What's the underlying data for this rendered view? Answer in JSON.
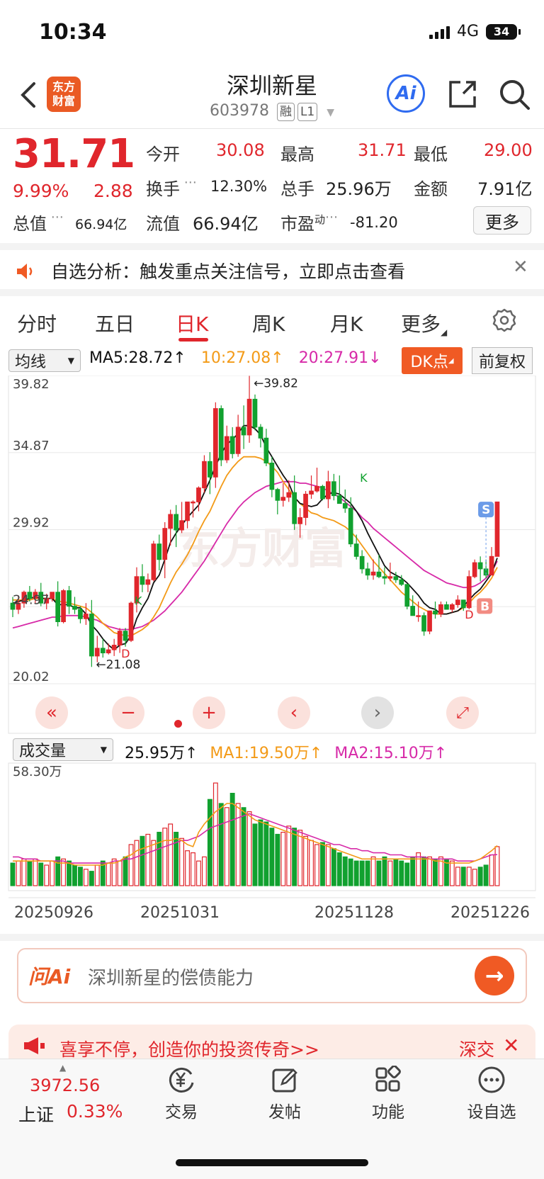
{
  "status_bar": {
    "time": "10:34",
    "network": "4G",
    "battery": "34"
  },
  "header": {
    "name": "深圳新星",
    "code": "603978",
    "tags": [
      "融",
      "L1"
    ],
    "logo_text": "东方财富",
    "ai_label": "Ai"
  },
  "quote": {
    "price": "31.71",
    "change_pct": "9.99%",
    "change_amt": "2.88",
    "fields": [
      {
        "label": "今开",
        "value": "30.08"
      },
      {
        "label": "最高",
        "value": "31.71"
      },
      {
        "label": "最低",
        "value": "29.00"
      },
      {
        "label": "换手",
        "value": "12.30%"
      },
      {
        "label": "总手",
        "value": "25.96万"
      },
      {
        "label": "金额",
        "value": "7.91亿"
      },
      {
        "label": "总值",
        "value": "66.94亿"
      },
      {
        "label": "流值",
        "value": "66.94亿"
      },
      {
        "label": "市盈",
        "value": "-81.20"
      }
    ],
    "pe_sup": "动",
    "more_label": "更多"
  },
  "news": {
    "text": "自选分析：触发重点关注信号，立即点击查看"
  },
  "tabs": [
    "分时",
    "五日",
    "日K",
    "周K",
    "月K",
    "更多"
  ],
  "indicator": {
    "selector": "均线",
    "ma5": "MA5:28.72",
    "ma10": "10:27.08",
    "ma20": "20:27.91",
    "dk_label": "DK点",
    "adjust_label": "前复权"
  },
  "chart_data": {
    "type": "candlestick",
    "y_ticks": [
      "39.82",
      "34.87",
      "29.92",
      "24.97",
      "20.02"
    ],
    "ylim": [
      20.02,
      39.82
    ],
    "high_annotation": "39.82",
    "low_annotation": "21.08",
    "markers": [
      "K",
      "K",
      "S",
      "B",
      "D",
      "D"
    ],
    "watermark": "东方财富",
    "candles": [
      [
        25.2,
        25.6,
        24.3,
        24.8
      ],
      [
        24.8,
        25.7,
        24.5,
        25.2
      ],
      [
        25.2,
        26.0,
        24.9,
        25.9
      ],
      [
        25.9,
        26.3,
        25.3,
        25.5
      ],
      [
        25.5,
        26.1,
        25.2,
        25.9
      ],
      [
        25.9,
        26.5,
        25.0,
        25.2
      ],
      [
        25.2,
        25.8,
        24.8,
        25.5
      ],
      [
        25.5,
        25.9,
        25.3,
        25.9
      ],
      [
        25.9,
        26.6,
        23.7,
        24.0
      ],
      [
        24.0,
        26.1,
        23.9,
        26.0
      ],
      [
        26.0,
        26.3,
        24.5,
        25.0
      ],
      [
        25.0,
        25.6,
        24.5,
        24.8
      ],
      [
        24.8,
        25.0,
        23.9,
        24.2
      ],
      [
        24.2,
        25.2,
        23.8,
        24.5
      ],
      [
        24.5,
        25.4,
        21.1,
        21.8
      ],
      [
        21.8,
        23.1,
        21.4,
        22.3
      ],
      [
        22.3,
        22.9,
        21.7,
        22.0
      ],
      [
        22.0,
        22.6,
        21.9,
        22.2
      ],
      [
        22.2,
        22.9,
        21.8,
        22.5
      ],
      [
        22.5,
        23.6,
        22.0,
        23.4
      ],
      [
        23.4,
        23.6,
        22.4,
        22.8
      ],
      [
        22.8,
        25.3,
        22.7,
        25.2
      ],
      [
        25.2,
        27.5,
        24.6,
        26.9
      ],
      [
        26.9,
        27.7,
        25.9,
        26.4
      ],
      [
        26.4,
        27.1,
        25.9,
        26.7
      ],
      [
        26.7,
        29.2,
        26.6,
        29.0
      ],
      [
        29.0,
        29.6,
        27.3,
        28.0
      ],
      [
        28.0,
        30.4,
        26.8,
        30.0
      ],
      [
        30.0,
        31.2,
        28.9,
        30.9
      ],
      [
        30.9,
        31.5,
        28.8,
        29.9
      ],
      [
        29.9,
        31.7,
        29.7,
        30.5
      ],
      [
        30.5,
        31.7,
        30.0,
        31.7
      ],
      [
        31.7,
        31.8,
        30.7,
        31.7
      ],
      [
        31.7,
        32.7,
        31.1,
        32.6
      ],
      [
        32.6,
        34.7,
        32.3,
        34.3
      ],
      [
        34.3,
        34.9,
        32.2,
        33.3
      ],
      [
        33.3,
        38.1,
        32.6,
        37.7
      ],
      [
        37.7,
        37.9,
        34.0,
        34.4
      ],
      [
        34.4,
        36.6,
        34.2,
        35.9
      ],
      [
        35.9,
        36.5,
        34.5,
        34.8
      ],
      [
        34.8,
        37.3,
        34.6,
        36.5
      ],
      [
        36.5,
        37.9,
        35.1,
        36.0
      ],
      [
        36.0,
        39.8,
        35.5,
        38.3
      ],
      [
        38.3,
        38.6,
        36.3,
        36.5
      ],
      [
        36.5,
        36.7,
        35.2,
        35.8
      ],
      [
        35.8,
        36.4,
        34.0,
        34.2
      ],
      [
        34.2,
        34.6,
        32.0,
        32.5
      ],
      [
        32.5,
        32.6,
        30.9,
        31.8
      ],
      [
        31.8,
        32.9,
        31.4,
        32.0
      ],
      [
        32.0,
        33.1,
        31.7,
        32.3
      ],
      [
        32.3,
        33.4,
        29.9,
        30.3
      ],
      [
        30.3,
        31.3,
        29.4,
        30.7
      ],
      [
        30.7,
        32.4,
        30.2,
        32.2
      ],
      [
        32.2,
        33.4,
        31.9,
        32.4
      ],
      [
        32.4,
        33.9,
        32.3,
        32.7
      ],
      [
        32.7,
        32.8,
        31.8,
        31.9
      ],
      [
        31.9,
        33.7,
        31.3,
        33.0
      ],
      [
        33.0,
        33.5,
        31.8,
        32.1
      ],
      [
        32.1,
        33.4,
        31.6,
        31.6
      ],
      [
        31.6,
        32.5,
        31.0,
        31.3
      ],
      [
        31.3,
        32.0,
        28.8,
        29.0
      ],
      [
        29.0,
        29.6,
        28.0,
        28.2
      ],
      [
        28.2,
        28.6,
        27.1,
        27.4
      ],
      [
        27.4,
        27.8,
        26.7,
        27.0
      ],
      [
        27.0,
        28.0,
        26.7,
        27.2
      ],
      [
        27.2,
        28.3,
        26.8,
        26.9
      ],
      [
        26.9,
        27.5,
        26.4,
        26.8
      ],
      [
        26.8,
        27.8,
        26.6,
        26.9
      ],
      [
        26.9,
        27.2,
        26.5,
        26.7
      ],
      [
        26.7,
        27.0,
        26.3,
        26.4
      ],
      [
        26.4,
        26.4,
        24.8,
        25.0
      ],
      [
        25.0,
        25.7,
        24.4,
        24.4
      ],
      [
        24.4,
        25.3,
        24.0,
        24.4
      ],
      [
        24.4,
        24.6,
        23.1,
        23.4
      ],
      [
        23.4,
        24.7,
        23.2,
        24.7
      ],
      [
        24.7,
        25.3,
        24.2,
        24.5
      ],
      [
        24.5,
        25.3,
        24.3,
        25.1
      ],
      [
        25.1,
        25.3,
        24.8,
        24.8
      ],
      [
        24.8,
        25.2,
        24.6,
        25.1
      ],
      [
        25.1,
        25.7,
        24.9,
        25.4
      ],
      [
        25.4,
        25.4,
        24.7,
        24.9
      ],
      [
        24.9,
        27.3,
        24.8,
        26.9
      ],
      [
        26.9,
        28.0,
        26.8,
        27.8
      ],
      [
        27.8,
        28.2,
        26.6,
        27.4
      ],
      [
        27.4,
        28.0,
        26.8,
        27.0
      ],
      [
        27.0,
        28.8,
        27.0,
        28.2
      ],
      [
        28.2,
        31.7,
        28.2,
        31.7
      ]
    ],
    "ma5": [
      25.2,
      25.3,
      25.4,
      25.5,
      25.6,
      25.5,
      25.5,
      25.5,
      25.1,
      25.1,
      25.1,
      24.9,
      24.9,
      24.5,
      23.8,
      23.4,
      22.9,
      22.5,
      22.2,
      22.5,
      22.6,
      23.1,
      24.2,
      24.9,
      25.5,
      26.5,
      27.0,
      28.0,
      29.1,
      29.7,
      30.2,
      30.7,
      31.1,
      31.5,
      32.3,
      33.1,
      34.0,
      34.8,
      35.4,
      35.7,
      36.1,
      36.6,
      36.6,
      36.4,
      36.0,
      35.2,
      34.6,
      34.0,
      33.4,
      32.9,
      32.0,
      31.6,
      31.5,
      31.4,
      31.5,
      31.9,
      32.2,
      32.3,
      32.2,
      31.9,
      31.6,
      31.1,
      30.5,
      29.7,
      29.0,
      28.3,
      27.6,
      27.2,
      27.0,
      26.8,
      26.5,
      26.1,
      25.7,
      25.2,
      24.9,
      24.8,
      24.5,
      24.5,
      24.6,
      24.7,
      25.0,
      25.4,
      25.8,
      26.1,
      26.6,
      27.1,
      28.1
    ],
    "ma10": [
      25.4,
      25.4,
      25.4,
      25.4,
      25.5,
      25.5,
      25.5,
      25.5,
      25.3,
      25.3,
      25.2,
      25.1,
      25.0,
      24.9,
      24.6,
      24.3,
      23.9,
      23.6,
      23.3,
      23.2,
      23.1,
      23.1,
      23.3,
      23.5,
      23.8,
      24.3,
      24.9,
      25.7,
      26.5,
      27.2,
      27.7,
      28.3,
      29.0,
      29.8,
      30.5,
      31.1,
      31.9,
      32.7,
      33.4,
      33.9,
      34.3,
      34.6,
      34.6,
      34.6,
      34.5,
      34.3,
      34.0,
      33.6,
      33.0,
      32.5,
      32.0,
      31.6,
      31.3,
      31.0,
      30.9,
      30.7,
      30.6,
      30.5,
      30.3,
      30.1,
      29.8,
      29.4,
      28.9,
      28.4,
      27.9,
      27.5,
      27.1,
      26.7,
      26.3,
      25.9,
      25.6,
      25.3,
      25.0,
      24.8,
      24.6,
      24.5,
      24.5,
      24.5,
      24.6,
      24.7,
      24.9,
      25.2,
      25.6,
      25.9,
      26.3,
      26.8,
      27.5
    ],
    "ma20": [
      23.6,
      23.7,
      23.8,
      23.9,
      24.0,
      24.1,
      24.2,
      24.3,
      24.3,
      24.4,
      24.4,
      24.4,
      24.4,
      24.3,
      24.2,
      24.1,
      23.9,
      23.7,
      23.6,
      23.5,
      23.5,
      23.5,
      23.6,
      23.7,
      23.9,
      24.1,
      24.4,
      24.7,
      25.1,
      25.5,
      25.9,
      26.4,
      26.9,
      27.4,
      27.9,
      28.5,
      29.1,
      29.7,
      30.3,
      30.8,
      31.3,
      31.7,
      32.0,
      32.3,
      32.5,
      32.7,
      32.8,
      32.9,
      33.0,
      33.0,
      33.0,
      32.9,
      32.9,
      32.8,
      32.7,
      32.6,
      32.4,
      32.2,
      32.0,
      31.7,
      31.4,
      31.1,
      30.7,
      30.4,
      30.0,
      29.7,
      29.4,
      29.1,
      28.8,
      28.5,
      28.2,
      27.9,
      27.6,
      27.3,
      27.1,
      26.9,
      26.7,
      26.5,
      26.4,
      26.3,
      26.2,
      26.2,
      26.3,
      26.5,
      26.8,
      27.2,
      27.9
    ]
  },
  "volume": {
    "selector": "成交量",
    "vol": "25.95万",
    "ma1": "MA1:19.50万",
    "ma2": "MA2:15.10万",
    "max_label": "58.30万",
    "max": 58.3,
    "bars": [
      11,
      12,
      13,
      12,
      13,
      11,
      10,
      12,
      14,
      13,
      12,
      10,
      9,
      8,
      7,
      10,
      12,
      11,
      13,
      12,
      14,
      20,
      22,
      24,
      25,
      22,
      26,
      28,
      30,
      26,
      23,
      17,
      16,
      12,
      14,
      42,
      50,
      40,
      38,
      45,
      40,
      38,
      36,
      30,
      32,
      31,
      28,
      25,
      26,
      29,
      28,
      27,
      24,
      22,
      20,
      21,
      20,
      18,
      16,
      14,
      13,
      12,
      12,
      12,
      14,
      12,
      14,
      12,
      13,
      12,
      11,
      14,
      16,
      14,
      14,
      13,
      14,
      13,
      12,
      9,
      9,
      9,
      8,
      9,
      10,
      15,
      19
    ],
    "ma1_line": [
      12,
      12,
      12,
      12,
      12,
      12,
      12,
      12,
      11,
      11,
      11,
      10,
      10,
      10,
      10,
      10,
      10,
      11,
      11,
      12,
      14,
      15,
      17,
      18,
      19,
      20,
      21,
      22,
      22,
      23,
      22,
      20,
      19,
      26,
      30,
      33,
      36,
      38,
      40,
      40,
      38,
      36,
      34,
      32,
      31,
      30,
      29,
      28,
      27,
      26,
      25,
      24,
      23,
      22,
      21,
      20,
      19,
      18,
      17,
      16,
      15,
      14,
      13,
      13,
      13,
      13,
      13,
      13,
      13,
      13,
      13,
      13,
      13,
      13,
      13,
      12,
      12,
      11,
      11,
      11,
      11,
      11,
      12,
      13,
      15,
      17,
      19.5
    ],
    "ma2_line": [
      14,
      14,
      13,
      13,
      13,
      12,
      12,
      12,
      12,
      12,
      11,
      11,
      11,
      11,
      11,
      11,
      11,
      11,
      12,
      12,
      13,
      13,
      14,
      15,
      16,
      17,
      18,
      19,
      20,
      21,
      22,
      22,
      23,
      24,
      26,
      28,
      29,
      30,
      31,
      32,
      33,
      34,
      35,
      34,
      33,
      32,
      31,
      30,
      29,
      28,
      27,
      26,
      25,
      24,
      23,
      22,
      21,
      20,
      20,
      19,
      18,
      18,
      17,
      17,
      16,
      16,
      16,
      15,
      15,
      15,
      14,
      14,
      14,
      14,
      13,
      13,
      13,
      13,
      13,
      12,
      12,
      12,
      12,
      13,
      14,
      15,
      15.1
    ]
  },
  "dates": [
    "20250926",
    "20251031",
    "20251128",
    "20251226"
  ],
  "ask_ai": {
    "brand": "问Ai",
    "question": "深圳新星的偿债能力"
  },
  "promo": {
    "text": "喜享不停，创造你的投资传奇>>",
    "right": "深交"
  },
  "bottom_nav": {
    "index_value": "3972.56",
    "index_name": "上证",
    "index_pct": "0.33%",
    "items": [
      "交易",
      "发帖",
      "功能",
      "设自选"
    ]
  },
  "colors": {
    "up": "#e0262c",
    "down": "#11a12f",
    "ma5": "#111111",
    "ma10": "#f39a17",
    "ma20": "#d72aa8"
  }
}
